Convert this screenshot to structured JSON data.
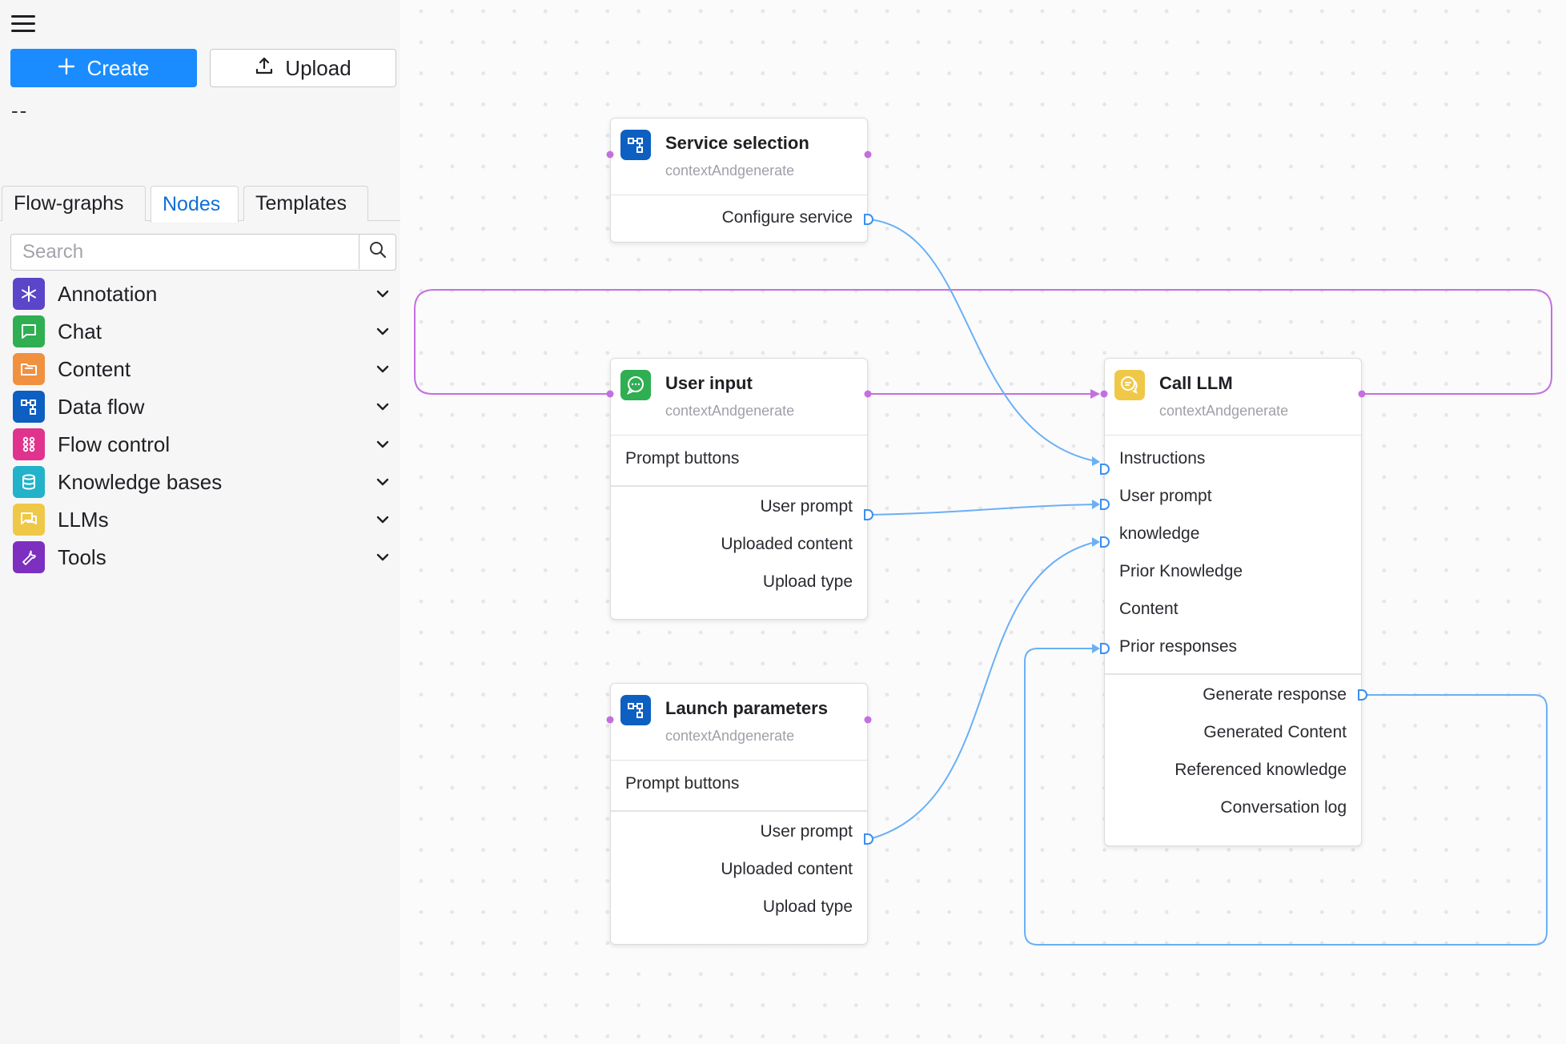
{
  "sidebar": {
    "create_label": "Create",
    "upload_label": "Upload",
    "status_text": "--",
    "tabs": [
      {
        "label": "Flow-graphs"
      },
      {
        "label": "Nodes"
      },
      {
        "label": "Templates"
      }
    ],
    "search_placeholder": "Search",
    "categories": [
      {
        "label": "Annotation",
        "icon": "asterisk-icon",
        "color": "#5b45c9"
      },
      {
        "label": "Chat",
        "icon": "chat-icon",
        "color": "#2fae52"
      },
      {
        "label": "Content",
        "icon": "folder-icon",
        "color": "#f0913f"
      },
      {
        "label": "Data flow",
        "icon": "data-flow-icon",
        "color": "#0d5fc2"
      },
      {
        "label": "Flow control",
        "icon": "grid-dots-icon",
        "color": "#e0338e"
      },
      {
        "label": "Knowledge bases",
        "icon": "database-icon",
        "color": "#22b2c9"
      },
      {
        "label": "LLMs",
        "icon": "llm-chat-icon",
        "color": "#f0c847"
      },
      {
        "label": "Tools",
        "icon": "wrench-icon",
        "color": "#7d2fc0"
      }
    ]
  },
  "nodes": {
    "service_selection": {
      "title": "Service selection",
      "subtitle": "contextAndgenerate",
      "outputs": [
        "Configure service"
      ]
    },
    "user_input": {
      "title": "User input",
      "subtitle": "contextAndgenerate",
      "section": "Prompt buttons",
      "outputs": [
        "User prompt",
        "Uploaded content",
        "Upload type"
      ]
    },
    "launch_parameters": {
      "title": "Launch parameters",
      "subtitle": "contextAndgenerate",
      "section": "Prompt buttons",
      "outputs": [
        "User prompt",
        "Uploaded content",
        "Upload type"
      ]
    },
    "call_llm": {
      "title": "Call LLM",
      "subtitle": "contextAndgenerate",
      "inputs": [
        "Instructions",
        "User prompt",
        "knowledge",
        "Prior Knowledge",
        "Content",
        "Prior responses"
      ],
      "outputs": [
        "Generate response",
        "Generated Content",
        "Referenced knowledge",
        "Conversation log"
      ]
    }
  },
  "colors": {
    "accent": "#1a8cff",
    "edge_data": "#6ab0f5",
    "edge_control": "#c46fe0"
  }
}
